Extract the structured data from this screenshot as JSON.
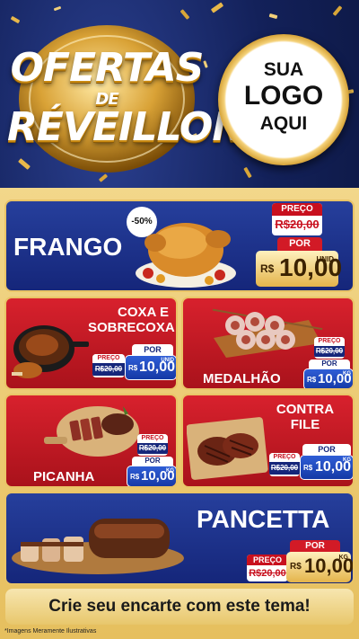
{
  "header": {
    "title_line1": "OFERTAS",
    "title_line2": "DE",
    "title_line3": "RÉVEILLON",
    "logo_line1": "SUA",
    "logo_line2": "LOGO",
    "logo_line3": "AQUI"
  },
  "products": [
    {
      "name": "FRANGO",
      "discount": "-50%",
      "old_label": "PREÇO",
      "old_price": "R$20,00",
      "por_label": "POR",
      "currency": "R$",
      "price": "10,00",
      "unit": "UNID"
    },
    {
      "name": "COXA E SOBRECOXA",
      "old_label": "PREÇO",
      "old_price": "R$20,00",
      "por_label": "POR",
      "currency": "R$",
      "price": "10,00",
      "unit": "UNID"
    },
    {
      "name": "MEDALHÃO",
      "old_label": "PREÇO",
      "old_price": "R$20,00",
      "por_label": "POR",
      "currency": "R$",
      "price": "10,00",
      "unit": "KG"
    },
    {
      "name": "PICANHA",
      "old_label": "PREÇO",
      "old_price": "R$20,00",
      "por_label": "POR",
      "currency": "R$",
      "price": "10,00",
      "unit": "KG"
    },
    {
      "name": "CONTRA FILE",
      "old_label": "PREÇO",
      "old_price": "R$20,00",
      "por_label": "POR",
      "currency": "R$",
      "price": "10,00",
      "unit": "KG"
    },
    {
      "name": "PANCETTA",
      "old_label": "PREÇO",
      "old_price": "R$20,00",
      "por_label": "POR",
      "currency": "R$",
      "price": "10,00",
      "unit": "KG"
    }
  ],
  "footer": {
    "cta": "Crie seu encarte com este tema!",
    "disclaimer": "*Imagens Meramente Ilustrativas"
  },
  "colors": {
    "navy": "#15267a",
    "red": "#c8101e",
    "gold": "#e4b44b"
  }
}
